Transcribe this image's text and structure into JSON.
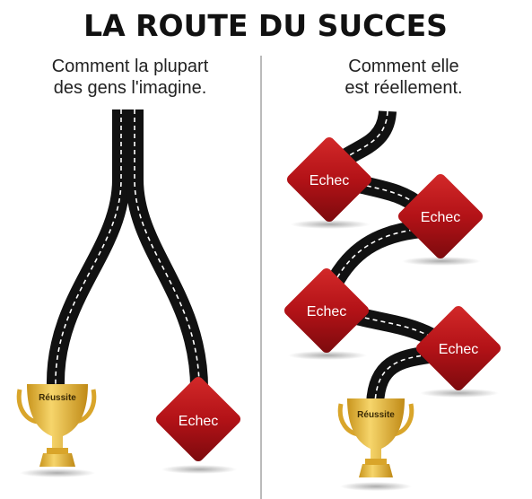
{
  "title": "LA ROUTE DU SUCCES",
  "left_panel": {
    "caption_line1": "Comment la plupart",
    "caption_line2": "des gens l'imagine.",
    "trophy_label": "Réussite",
    "fail_label": "Echec"
  },
  "right_panel": {
    "caption_line1": "Comment elle",
    "caption_line2": "est réellement.",
    "fail_labels": [
      "Echec",
      "Echec",
      "Echec",
      "Echec"
    ],
    "trophy_label": "Réussite"
  },
  "colors": {
    "background": "#ffffff",
    "road": "#111111",
    "road_marking": "#ffffff",
    "diamond": "#b31217",
    "trophy": "#e9b93a",
    "divider": "#bbbbbb",
    "title": "#111111"
  }
}
